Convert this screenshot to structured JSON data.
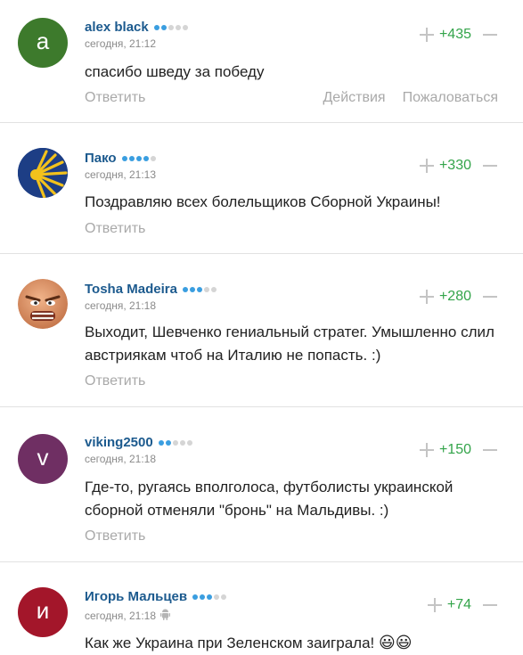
{
  "comments": [
    {
      "author": "alex black",
      "rating_dots": 2,
      "avatar_letter": "a",
      "avatar_color": "#3d7a2c",
      "timestamp": "сегодня, 21:12",
      "score": "+435",
      "text": "спасибо шведу за победу",
      "reply_label": "Ответить",
      "actions_label": "Действия",
      "report_label": "Пожаловаться"
    },
    {
      "author": "Пако",
      "rating_dots": 4,
      "avatar_icon": "scallop-shell-icon",
      "timestamp": "сегодня, 21:13",
      "score": "+330",
      "text": "Поздравляю всех болельщиков Сборной Украины!",
      "reply_label": "Ответить"
    },
    {
      "author": "Tosha Madeira",
      "rating_dots": 3,
      "avatar_icon": "angry-face-icon",
      "timestamp": "сегодня, 21:18",
      "score": "+280",
      "text": "Выходит, Шевченко гениальный стратег. Умышленно слил австриякам чтоб на Италию не попасть. :)",
      "reply_label": "Ответить"
    },
    {
      "author": "viking2500",
      "rating_dots": 2,
      "avatar_letter": "v",
      "avatar_color": "#6f2f63",
      "timestamp": "сегодня, 21:18",
      "score": "+150",
      "text": "Где-то, ругаясь вполголоса, футболисты украинской сборной отменяли \"бронь\" на Мальдивы. :)",
      "reply_label": "Ответить"
    },
    {
      "author": "Игорь Мальцев",
      "rating_dots": 3,
      "avatar_letter": "и",
      "avatar_color": "#a3162a",
      "timestamp": "сегодня, 21:18",
      "device_icon": "android-icon",
      "score": "+74",
      "text": "Как же Украина при Зеленском заиграла!",
      "emoji": "😃😃"
    }
  ],
  "colors": {
    "author_link": "#1c5a8e",
    "rating_dot_active": "#3a9ee0",
    "score_positive": "#33a44a",
    "muted_text": "#a9a9a9"
  }
}
